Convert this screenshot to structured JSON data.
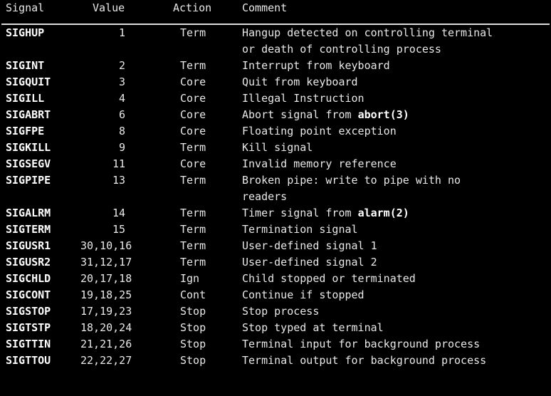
{
  "terminal": {
    "background_color": "#000000",
    "text_color": "#e8e8e8",
    "bold_color": "#ffffff"
  },
  "table": {
    "headers": {
      "signal": "Signal",
      "value": "Value",
      "action": "Action",
      "comment": "Comment"
    },
    "rows": [
      {
        "signal": "SIGHUP",
        "value": "1",
        "value_kind": "num",
        "action": "Term",
        "comment": "Hangup detected on controlling terminal",
        "comment_cont": "or death of controlling process"
      },
      {
        "signal": "SIGINT",
        "value": "2",
        "value_kind": "num",
        "action": "Term",
        "comment": "Interrupt from keyboard"
      },
      {
        "signal": "SIGQUIT",
        "value": "3",
        "value_kind": "num",
        "action": "Core",
        "comment": "Quit from keyboard"
      },
      {
        "signal": "SIGILL",
        "value": "4",
        "value_kind": "num",
        "action": "Core",
        "comment": "Illegal Instruction"
      },
      {
        "signal": "SIGABRT",
        "value": "6",
        "value_kind": "num",
        "action": "Core",
        "comment_pre": "Abort signal from ",
        "comment_bold": "abort(3)",
        "comment_post": ""
      },
      {
        "signal": "SIGFPE",
        "value": "8",
        "value_kind": "num",
        "action": "Core",
        "comment": "Floating point exception"
      },
      {
        "signal": "SIGKILL",
        "value": "9",
        "value_kind": "num",
        "action": "Term",
        "comment": "Kill signal"
      },
      {
        "signal": "SIGSEGV",
        "value": "11",
        "value_kind": "num",
        "action": "Core",
        "comment": "Invalid memory reference"
      },
      {
        "signal": "SIGPIPE",
        "value": "13",
        "value_kind": "num",
        "action": "Term",
        "comment": "Broken pipe: write to pipe with no",
        "comment_cont": "readers"
      },
      {
        "signal": "SIGALRM",
        "value": "14",
        "value_kind": "num",
        "action": "Term",
        "comment_pre": "Timer signal from ",
        "comment_bold": "alarm(2)",
        "comment_post": ""
      },
      {
        "signal": "SIGTERM",
        "value": "15",
        "value_kind": "num",
        "action": "Term",
        "comment": "Termination signal"
      },
      {
        "signal": "SIGUSR1",
        "value": "30,10,16",
        "value_kind": "list",
        "action": "Term",
        "comment": "User-defined signal 1"
      },
      {
        "signal": "SIGUSR2",
        "value": "31,12,17",
        "value_kind": "list",
        "action": "Term",
        "comment": "User-defined signal 2"
      },
      {
        "signal": "SIGCHLD",
        "value": "20,17,18",
        "value_kind": "list",
        "action": "Ign",
        "comment": "Child stopped or terminated"
      },
      {
        "signal": "SIGCONT",
        "value": "19,18,25",
        "value_kind": "list",
        "action": "Cont",
        "comment": "Continue if stopped"
      },
      {
        "signal": "SIGSTOP",
        "value": "17,19,23",
        "value_kind": "list",
        "action": "Stop",
        "comment": "Stop process"
      },
      {
        "signal": "SIGTSTP",
        "value": "18,20,24",
        "value_kind": "list",
        "action": "Stop",
        "comment": "Stop typed at terminal"
      },
      {
        "signal": "SIGTTIN",
        "value": "21,21,26",
        "value_kind": "list",
        "action": "Stop",
        "comment": "Terminal input for background process"
      },
      {
        "signal": "SIGTTOU",
        "value": "22,22,27",
        "value_kind": "list",
        "action": "Stop",
        "comment": "Terminal output for background process"
      }
    ]
  }
}
